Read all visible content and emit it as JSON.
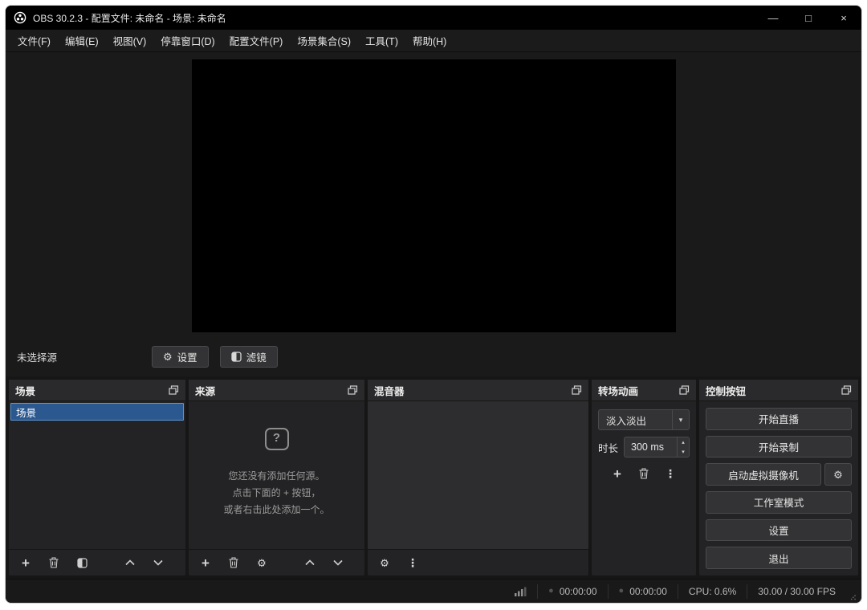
{
  "window": {
    "title": "OBS 30.2.3 - 配置文件: 未命名 - 场景: 未命名",
    "minimize_glyph": "—",
    "maximize_glyph": "□",
    "close_glyph": "×"
  },
  "menu": {
    "items": [
      "文件(F)",
      "编辑(E)",
      "视图(V)",
      "停靠窗口(D)",
      "配置文件(P)",
      "场景集合(S)",
      "工具(T)",
      "帮助(H)"
    ]
  },
  "preview": {
    "no_source_label": "未选择源",
    "settings_label": "设置",
    "filters_label": "滤镜"
  },
  "docks": {
    "scenes": {
      "title": "场景",
      "items": [
        {
          "label": "场景",
          "selected": true
        }
      ]
    },
    "sources": {
      "title": "来源",
      "placeholder_glyph": "?",
      "empty": [
        "您还没有添加任何源。",
        "点击下面的 + 按钮，",
        "或者右击此处添加一个。"
      ]
    },
    "mixer": {
      "title": "混音器"
    },
    "transitions": {
      "title": "转场动画",
      "selected_transition": "淡入淡出",
      "duration_label": "时长",
      "duration_value": "300 ms"
    },
    "controls": {
      "title": "控制按钮",
      "start_streaming": "开始直播",
      "start_recording": "开始录制",
      "virtual_camera": "启动虚拟摄像机",
      "studio_mode": "工作室模式",
      "settings": "设置",
      "exit": "退出"
    }
  },
  "statusbar": {
    "recording_timer": "00:00:00",
    "streaming_timer": "00:00:00",
    "cpu": "CPU: 0.6%",
    "fps": "30.00 / 30.00 FPS"
  },
  "icons": {
    "gear": "⚙",
    "plus": "+",
    "dots": "⋮",
    "arrow_down": "▾",
    "spin_up": "▴",
    "spin_down": "▾",
    "record_dot": "●"
  }
}
